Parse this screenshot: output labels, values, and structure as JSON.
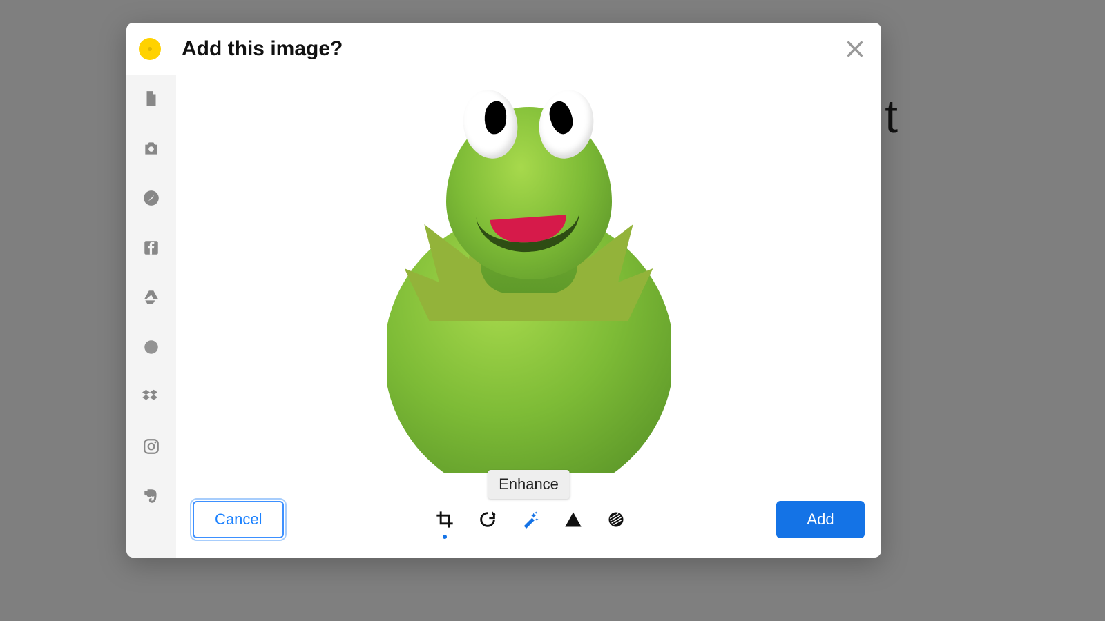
{
  "background": {
    "color": "#7f7f7f",
    "visible_char": "t"
  },
  "modal": {
    "title": "Add this image?",
    "brand_color": "#ffd200",
    "preview_description": "Green frog puppet portrait",
    "close_button": {
      "label": "Close"
    },
    "sidebar": {
      "items": [
        {
          "id": "file",
          "label": "File"
        },
        {
          "id": "camera",
          "label": "Camera"
        },
        {
          "id": "safari",
          "label": "Web"
        },
        {
          "id": "facebook",
          "label": "Facebook"
        },
        {
          "id": "gdrive",
          "label": "Google Drive"
        },
        {
          "id": "gphotos",
          "label": "Google Photos"
        },
        {
          "id": "dropbox",
          "label": "Dropbox"
        },
        {
          "id": "instagram",
          "label": "Instagram"
        },
        {
          "id": "evernote",
          "label": "Evernote"
        }
      ]
    },
    "toolbar": {
      "items": [
        {
          "id": "crop",
          "label": "Crop",
          "active": false,
          "has_indicator": true
        },
        {
          "id": "rotate",
          "label": "Rotate",
          "active": false,
          "has_indicator": false
        },
        {
          "id": "enhance",
          "label": "Enhance",
          "active": true,
          "has_indicator": false
        },
        {
          "id": "sharpen",
          "label": "Sharpen",
          "active": false,
          "has_indicator": false
        },
        {
          "id": "circle",
          "label": "Circle",
          "active": false,
          "has_indicator": false
        }
      ],
      "tooltip": "Enhance"
    },
    "buttons": {
      "cancel": "Cancel",
      "add": "Add"
    },
    "colors": {
      "primary": "#1473e6",
      "sidebar_bg": "#f4f4f4",
      "icon": "#888888"
    }
  }
}
